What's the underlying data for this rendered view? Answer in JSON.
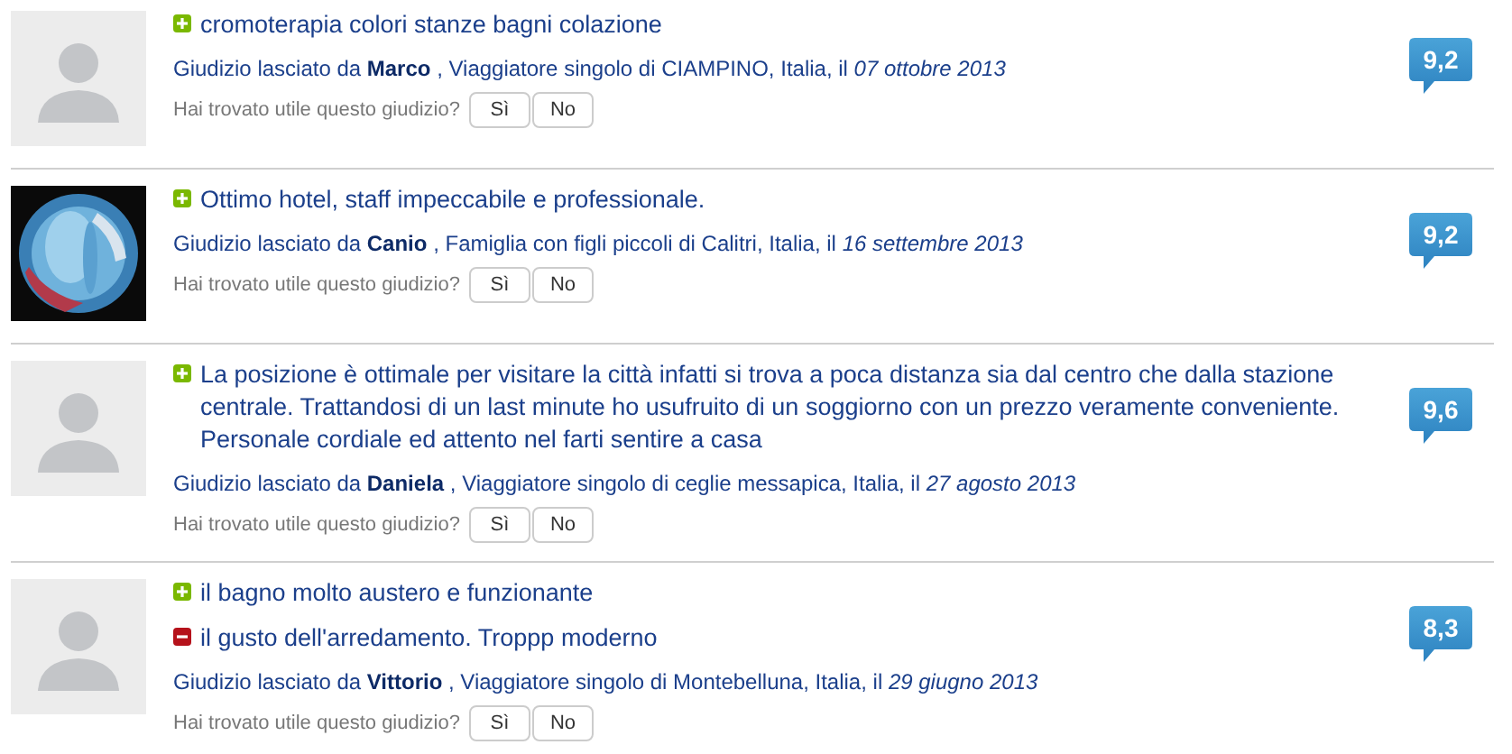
{
  "reviews": [
    {
      "avatar": {
        "kind": "placeholder"
      },
      "comments": [
        {
          "kind": "positive",
          "text": "cromoterapia colori stanze bagni colazione"
        }
      ],
      "author_line": "Giudizio lasciato da **Marco** , Viaggiatore singolo di CIAMPINO, Italia, il *07 ottobre 2013*",
      "question": "Hai trovato utile questo giudizio?",
      "buttons": [
        "Sì",
        "No"
      ],
      "score": "9,2"
    },
    {
      "avatar": {
        "kind": "picture"
      },
      "comments": [
        {
          "kind": "positive",
          "text": "Ottimo hotel, staff impeccabile e professionale."
        }
      ],
      "author_line": "Giudizio lasciato da **Canio** , Famiglia con figli piccoli di Calitri, Italia, il *16 settembre 2013*",
      "question": "Hai trovato utile questo giudizio?",
      "buttons": [
        "Sì",
        "No"
      ],
      "score": "9,2"
    },
    {
      "avatar": {
        "kind": "placeholder"
      },
      "comments": [
        {
          "kind": "positive",
          "text": "La posizione è ottimale per visitare la città infatti si trova a poca distanza sia dal centro che dalla stazione centrale. Trattandosi di un last minute ho usufruito di un soggiorno con un prezzo veramente conveniente. Personale cordiale ed attento nel farti sentire a casa"
        }
      ],
      "author_line": "Giudizio lasciato da **Daniela** , Viaggiatore singolo di ceglie messapica, Italia, il *27 agosto 2013*",
      "question": "Hai trovato utile questo giudizio?",
      "buttons": [
        "Sì",
        "No"
      ],
      "score": "9,6"
    },
    {
      "avatar": {
        "kind": "placeholder"
      },
      "comments": [
        {
          "kind": "positive",
          "text": "il bagno molto austero e funzionante"
        },
        {
          "kind": "negative",
          "text": "il gusto dell'arredamento. Troppp moderno"
        }
      ],
      "author_line": "Giudizio lasciato da **Vittorio** , Viaggiatore singolo di Montebelluna, Italia, il *29 giugno 2013*",
      "question": "Hai trovato utile questo giudizio?",
      "buttons": [
        "Sì",
        "No"
      ],
      "score": "8,3"
    }
  ]
}
